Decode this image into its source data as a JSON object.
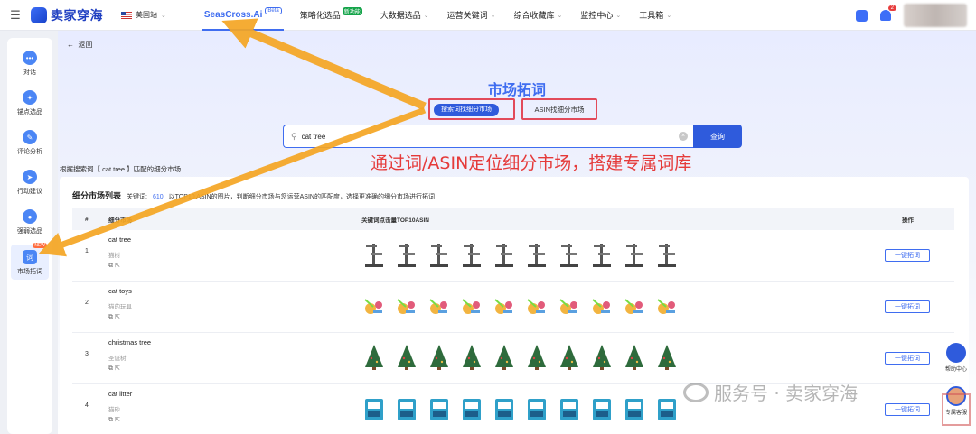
{
  "topbar": {
    "brand": "卖家穿海",
    "region": "美国站",
    "nav": [
      {
        "label": "SeasCross.Ai",
        "badge": "Beta",
        "active": true
      },
      {
        "label": "策略化选品",
        "badge_new": "新功能"
      },
      {
        "label": "大数据选品",
        "caret": true
      },
      {
        "label": "运营关键词",
        "caret": true
      },
      {
        "label": "综合收藏库",
        "caret": true
      },
      {
        "label": "监控中心",
        "caret": true
      },
      {
        "label": "工具箱",
        "caret": true
      }
    ],
    "notification_count": "2"
  },
  "sidebar": {
    "items": [
      {
        "label": "对话",
        "icon": "chat-icon"
      },
      {
        "label": "锚点选品",
        "icon": "anchor-icon"
      },
      {
        "label": "评论分析",
        "icon": "comment-icon"
      },
      {
        "label": "行动建议",
        "icon": "compass-icon"
      },
      {
        "label": "强弱选品",
        "icon": "user-icon"
      },
      {
        "label": "市场拓词",
        "icon": "market-icon",
        "active": true,
        "tag": "NEW"
      }
    ]
  },
  "page": {
    "back": "返回",
    "title": "市场拓词",
    "tabs": [
      "搜索词找细分市场",
      "ASIN找细分市场"
    ],
    "search": {
      "value": "cat tree",
      "button": "查询"
    },
    "slogan": "通过词/ASIN定位细分市场，搭建专属词库",
    "match_line": "根据搜索词【 cat tree 】匹配的细分市场"
  },
  "list": {
    "title": "细分市场列表",
    "keyword_label": "关键词:",
    "keyword_count": "610",
    "hint": "以TOP10 ASIN的图片，判断细分市场与您运营ASIN的匹配度，选择更准确的细分市场进行拓词",
    "columns": [
      "#",
      "细分市场",
      "关键词点击量TOP10ASIN",
      "操作"
    ],
    "rows": [
      {
        "idx": "1",
        "keyword": "cat tree",
        "cn": "猫树",
        "action": "一键拓词",
        "thumb_type": "tower"
      },
      {
        "idx": "2",
        "keyword": "cat toys",
        "cn": "猫的玩具",
        "action": "一键拓词",
        "thumb_type": "toy"
      },
      {
        "idx": "3",
        "keyword": "christmas tree",
        "cn": "圣诞树",
        "action": "一键拓词",
        "thumb_type": "xmas"
      },
      {
        "idx": "4",
        "keyword": "cat litter",
        "cn": "猫砂",
        "action": "一键拓词",
        "thumb_type": "bag"
      }
    ]
  },
  "float": {
    "help": "帮助中心",
    "consult": "专属客服"
  },
  "watermark": {
    "text": "服务号 · 卖家穿海",
    "seal": "卖家穿海"
  },
  "colors": {
    "accent": "#3f6df0",
    "highlight": "#e24a5a",
    "arrow": "#f5a623",
    "slogan": "#e53a3a"
  }
}
